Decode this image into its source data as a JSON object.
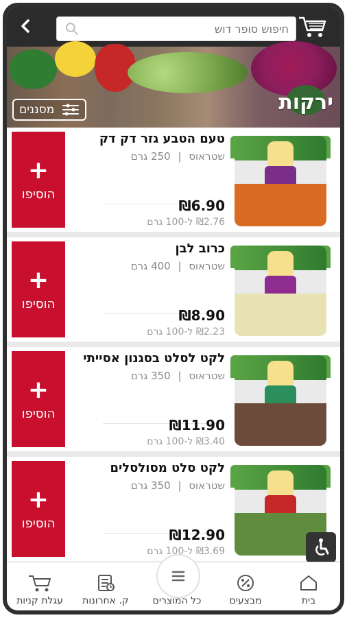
{
  "header": {
    "search_placeholder": "חיפוש סופר דוש"
  },
  "hero": {
    "title": "ירקות",
    "filter_label": "מסננים"
  },
  "products": [
    {
      "name": "טעם הטבע גזר דק דק",
      "brand": "שטראוס",
      "size": "250 גרם",
      "price": "₪6.90",
      "unit_price": "₪2.76 ל-100 גרם",
      "add_label": "הוסיפו",
      "package_color": "#d96b23"
    },
    {
      "name": "כרוב לבן",
      "brand": "שטראוס",
      "size": "400 גרם",
      "price": "₪8.90",
      "unit_price": "₪2.23 ל-100 גרם",
      "add_label": "הוסיפו",
      "package_color": "#e8e2b5"
    },
    {
      "name": "לקט לסלט בסגנון אסייתי",
      "brand": "שטראוס",
      "size": "350 גרם",
      "price": "₪11.90",
      "unit_price": "₪3.40 ל-100 גרם",
      "add_label": "הוסיפו",
      "package_color": "#6d4b3b"
    },
    {
      "name": "לקט סלט מסולסלים",
      "brand": "שטראוס",
      "size": "350 גרם",
      "price": "₪12.90",
      "unit_price": "₪3.69 ל-100 גרם",
      "add_label": "הוסיפו",
      "package_color": "#5f8d3d"
    }
  ],
  "bottom_nav": {
    "home": "בית",
    "promotions": "מבצעים",
    "all_products": "כל המוצרים",
    "recent_purchases": "ק. אחרונות",
    "cart": "עגלת קניות"
  },
  "colors": {
    "accent_red": "#c8102e",
    "topbar": "#2b2b2b"
  },
  "icons": {
    "back": "chevron-left-icon",
    "search": "search-icon",
    "cart": "cart-icon",
    "filter": "filter-icon",
    "accessibility": "wheelchair-icon"
  }
}
